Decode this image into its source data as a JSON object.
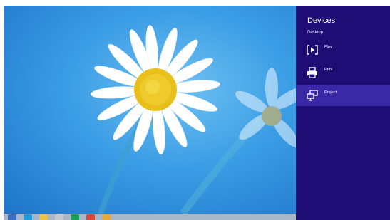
{
  "charm": {
    "title": "Devices",
    "subtitle": "Desktop",
    "items": [
      {
        "label": "Play",
        "icon": "play-icon"
      },
      {
        "label": "Print",
        "icon": "printer-icon"
      },
      {
        "label": "Project",
        "icon": "project-icon",
        "selected": true
      }
    ]
  },
  "taskbar": {
    "icons": [
      "windows-start-icon",
      "internet-explorer-icon",
      "file-explorer-icon",
      "paint-icon",
      "store-icon",
      "media-icon",
      "chrome-icon"
    ]
  },
  "colors": {
    "charm_background": "#1d0d74",
    "charm_selected": "#3a29a6",
    "taskbar": "#a7b7c9",
    "wallpaper": "#3b9de5"
  }
}
